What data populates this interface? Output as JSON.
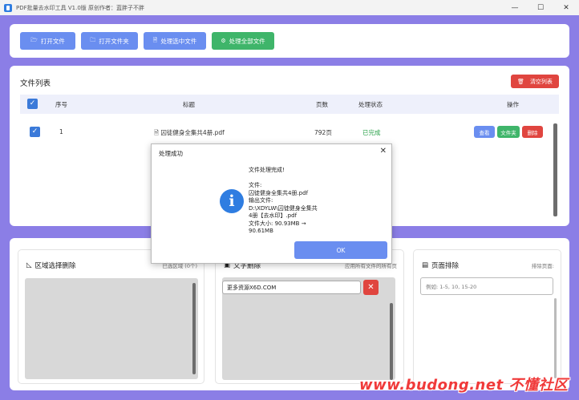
{
  "window": {
    "title": "PDF批量去水印工具 V1.0版    原创作者：蓝胖子不胖",
    "controls": [
      "—",
      "☐",
      "✕"
    ]
  },
  "toolbar": {
    "buttons": [
      {
        "label": "打开文件",
        "icon": "folder-open-icon"
      },
      {
        "label": "打开文件夹",
        "icon": "folder-icon"
      },
      {
        "label": "处理选中文件",
        "icon": "file-icon"
      },
      {
        "label": "处理全部文件",
        "icon": "gear-icon"
      }
    ]
  },
  "filelist": {
    "title": "文件列表",
    "clear_label": "清空列表",
    "columns": [
      "序号",
      "标题",
      "页数",
      "处理状态",
      "操作"
    ],
    "rows": [
      {
        "index": "1",
        "title": "囚徒健身全集共4册.pdf",
        "pages": "792页",
        "status": "已完成"
      }
    ],
    "row_actions": [
      "查看",
      "文件夹",
      "删除"
    ]
  },
  "panels": {
    "region": {
      "title": "区域选择删除",
      "note": "已选区域 (0个)"
    },
    "text": {
      "title": "文字删除",
      "note": "应用所有文件的所有页",
      "watermark_text": "更多资源X6D.COM"
    },
    "page": {
      "title": "页面排除",
      "note": "排除页面:",
      "placeholder": "例如: 1-5, 10, 15-20"
    }
  },
  "dialog": {
    "title": "处理成功",
    "message": "文件处理完成!\n\n文件:\n囚徒健身全集共4册.pdf\n输出文件:\nD:\\XDYLW\\囚徒健身全集共\n4册【去水印】.pdf\n文件大小: 90.93MB →\n90.61MB",
    "ok_label": "OK"
  },
  "overlay_banner": "www.budong.net 不懂社区",
  "colors": {
    "frame": "#8b7ee6",
    "primary": "#6a8ef0",
    "success": "#3fb56a",
    "danger": "#e0453f"
  }
}
